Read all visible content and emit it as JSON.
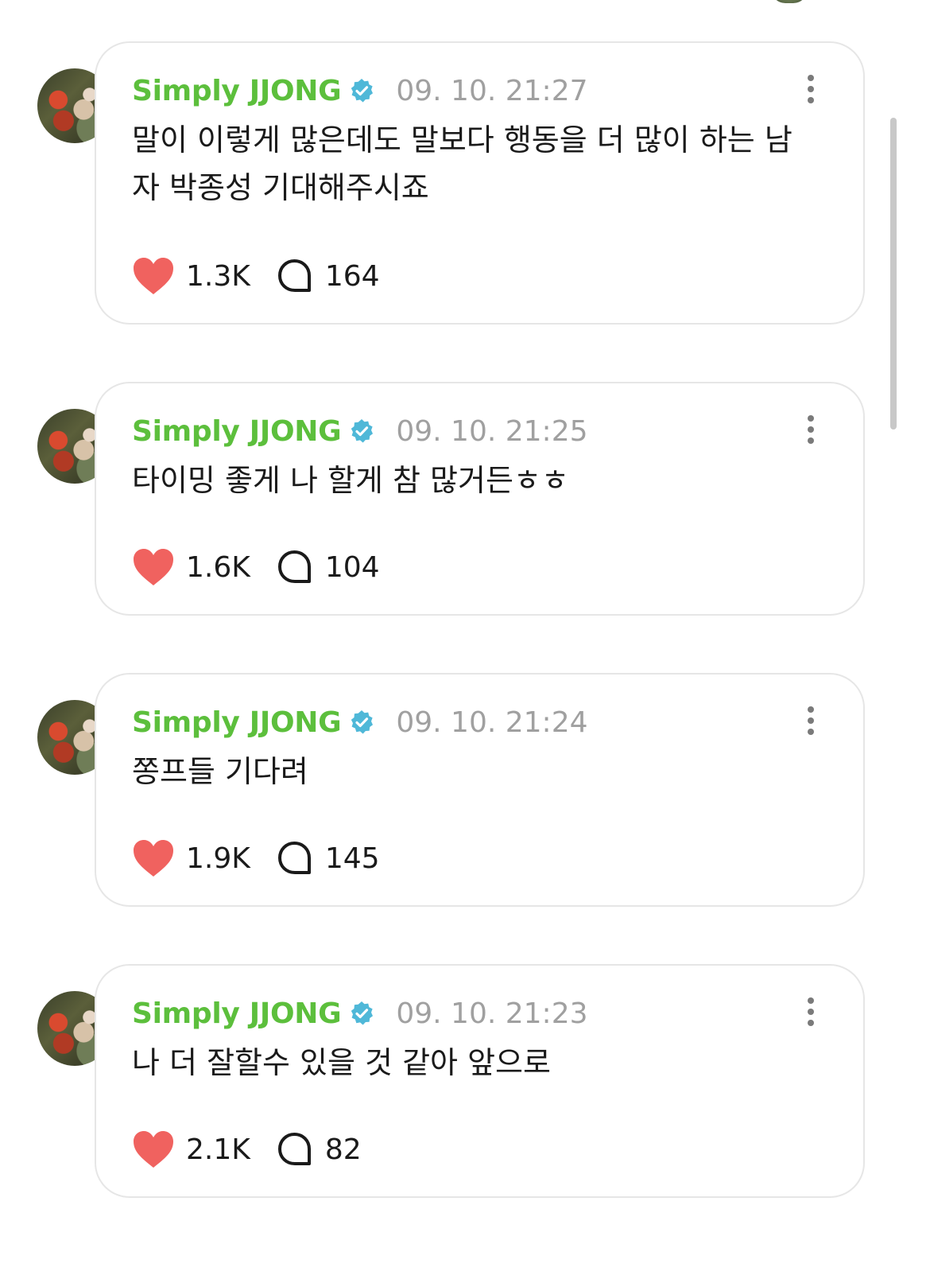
{
  "posts": [
    {
      "username": "Simply JJONG",
      "timestamp": "09. 10. 21:27",
      "text": "말이 이렇게 많은데도 말보다 행동을 더 많이 하는 남자 박종성 기대해주시죠",
      "likes": "1.3K",
      "comments": "164"
    },
    {
      "username": "Simply JJONG",
      "timestamp": "09. 10. 21:25",
      "text": "타이밍 좋게 나 할게 참 많거든ㅎㅎ",
      "likes": "1.6K",
      "comments": "104"
    },
    {
      "username": "Simply JJONG",
      "timestamp": "09. 10. 21:24",
      "text": "쫑프들 기다려",
      "likes": "1.9K",
      "comments": "145"
    },
    {
      "username": "Simply JJONG",
      "timestamp": "09. 10. 21:23",
      "text": "나 더 잘할수 있을 것 같아 앞으로",
      "likes": "2.1K",
      "comments": "82"
    }
  ],
  "colors": {
    "username": "#5cbf3c",
    "verified": "#4fb8d8",
    "heart": "#f0625f",
    "timestamp": "#a0a0a0"
  }
}
